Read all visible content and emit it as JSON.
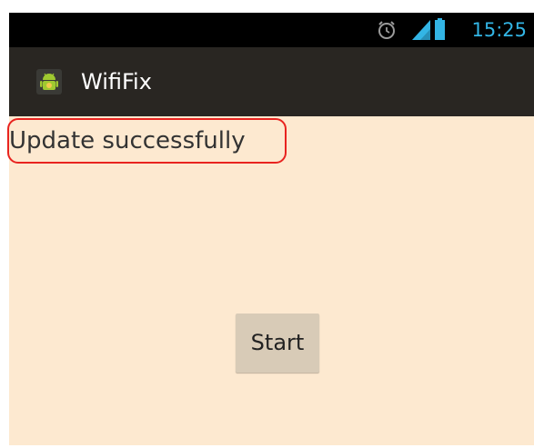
{
  "status_bar": {
    "time": "15:25",
    "icons": [
      "alarm-icon",
      "signal-icon",
      "battery-icon"
    ]
  },
  "action_bar": {
    "app_icon": "android-icon",
    "title": "WifiFix"
  },
  "main": {
    "message": "Update successfully",
    "start_button_label": "Start"
  },
  "colors": {
    "status_bar_bg": "#000000",
    "action_bar_bg": "#292622",
    "content_bg": "#fde9d0",
    "button_bg": "#d8cbb7",
    "highlight": "#e8231f",
    "status_accent": "#33b5e5"
  }
}
